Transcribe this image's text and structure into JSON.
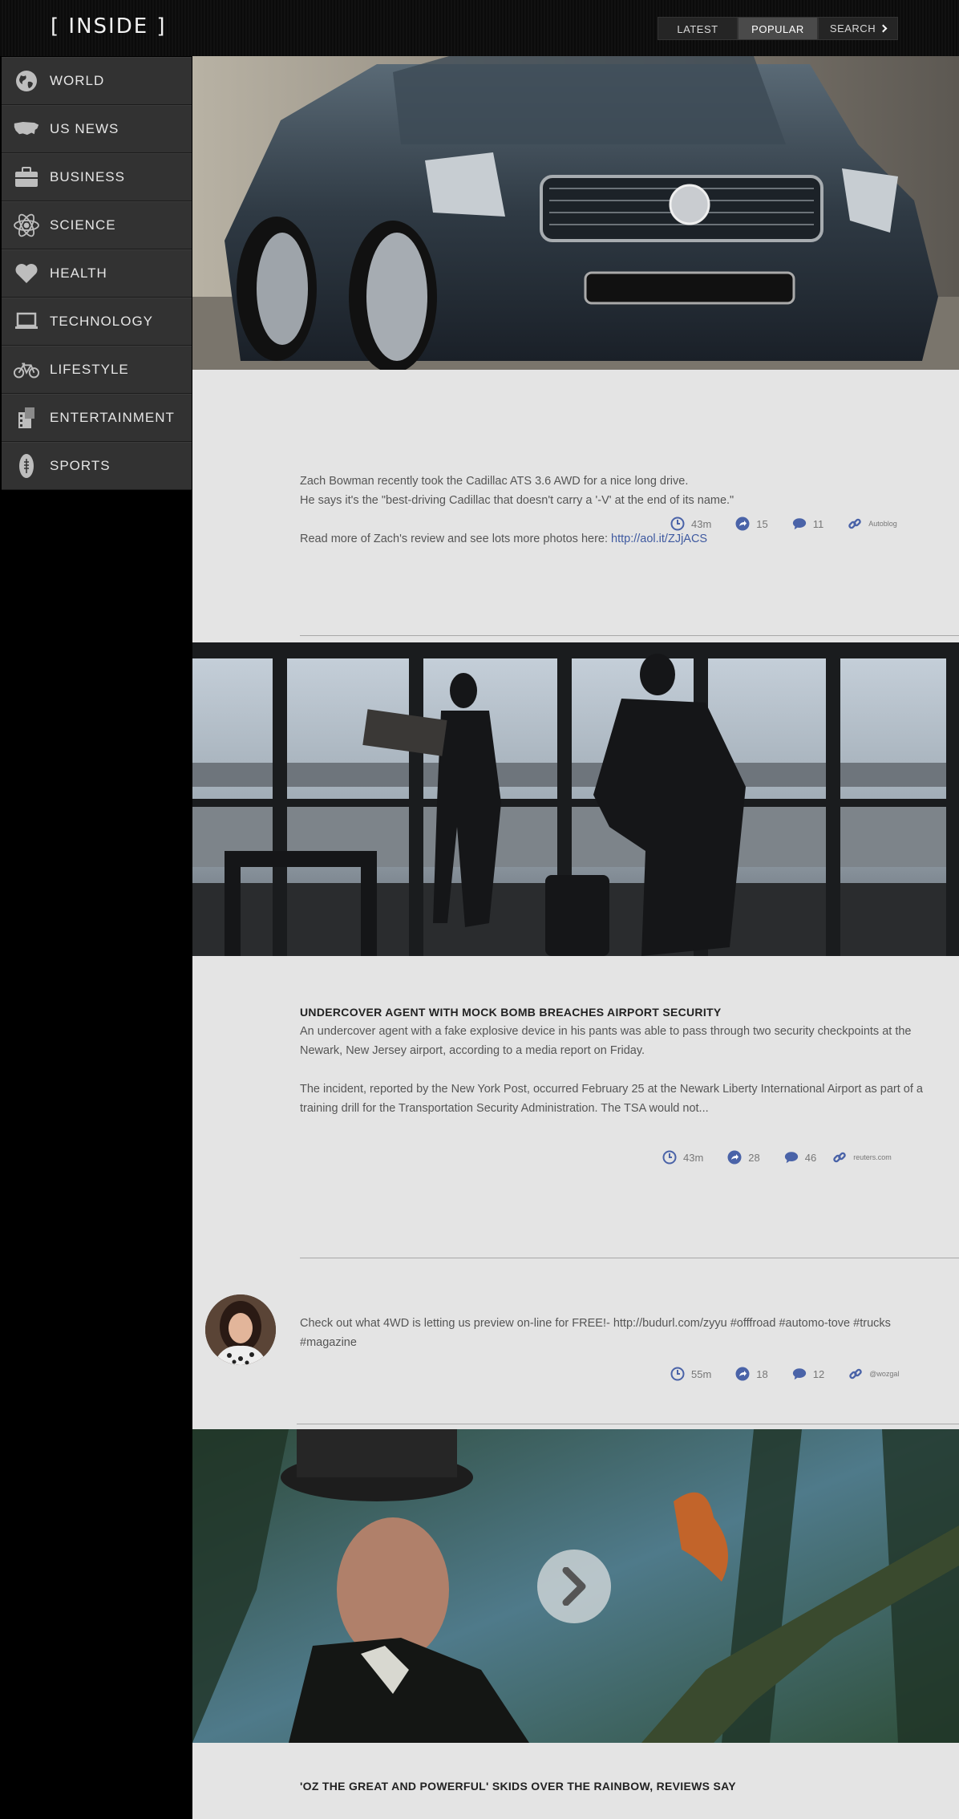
{
  "header": {
    "logo": "[ INSIDE ]",
    "nav": {
      "latest": "LATEST",
      "popular": "POPULAR",
      "search": "SEARCH"
    }
  },
  "sidebar": {
    "items": [
      {
        "label": "WORLD",
        "icon": "globe-icon"
      },
      {
        "label": "US NEWS",
        "icon": "us-map-icon"
      },
      {
        "label": "BUSINESS",
        "icon": "briefcase-icon"
      },
      {
        "label": "SCIENCE",
        "icon": "atom-icon"
      },
      {
        "label": "HEALTH",
        "icon": "heart-icon"
      },
      {
        "label": "TECHNOLOGY",
        "icon": "laptop-icon"
      },
      {
        "label": "LIFESTYLE",
        "icon": "bicycle-icon"
      },
      {
        "label": "ENTERTAINMENT",
        "icon": "film-icon"
      },
      {
        "label": "SPORTS",
        "icon": "football-icon"
      }
    ]
  },
  "articles": [
    {
      "image": "cadillac-photo",
      "line1": "Zach Bowman recently took the Cadillac ATS 3.6 AWD for a nice long drive.",
      "line2": "He says it's the \"best-driving Cadillac that doesn't carry a '-V' at the end of its name.\"",
      "read_more": "Read more of Zach's review and see lots more photos here: ",
      "link": "http://aol.it/ZJjACS",
      "time": "43m",
      "shares": "15",
      "comments": "11",
      "source": "Autoblog"
    },
    {
      "image": "airport-photo",
      "title": "UNDERCOVER AGENT WITH MOCK BOMB BREACHES AIRPORT SECURITY",
      "para1": "An undercover agent with a fake explosive device in his pants was able to pass through two security checkpoints at the Newark, New Jersey airport, according to a media report on Friday.",
      "para2": "The incident, reported by the New York Post, occurred February 25 at the Newark Liberty International Airport as part of a training drill for the Transportation Security Administration. The TSA would not...",
      "time": "43m",
      "shares": "28",
      "comments": "46",
      "source": "reuters.com"
    },
    {
      "text": "Check out what 4WD is letting us preview on-line for FREE!- http://budurl.com/zyyu #offfroad #automo-tove #trucks #magazine",
      "time": "55m",
      "shares": "18",
      "comments": "12",
      "source": "@wozgal"
    },
    {
      "image": "oz-movie-photo",
      "title": "'OZ THE GREAT AND POWERFUL' SKIDS OVER THE RAINBOW, REVIEWS SAY"
    }
  ],
  "colors": {
    "accent": "#4a63a8",
    "content_bg": "#e4e4e4",
    "sidebar_bg": "#323232"
  }
}
